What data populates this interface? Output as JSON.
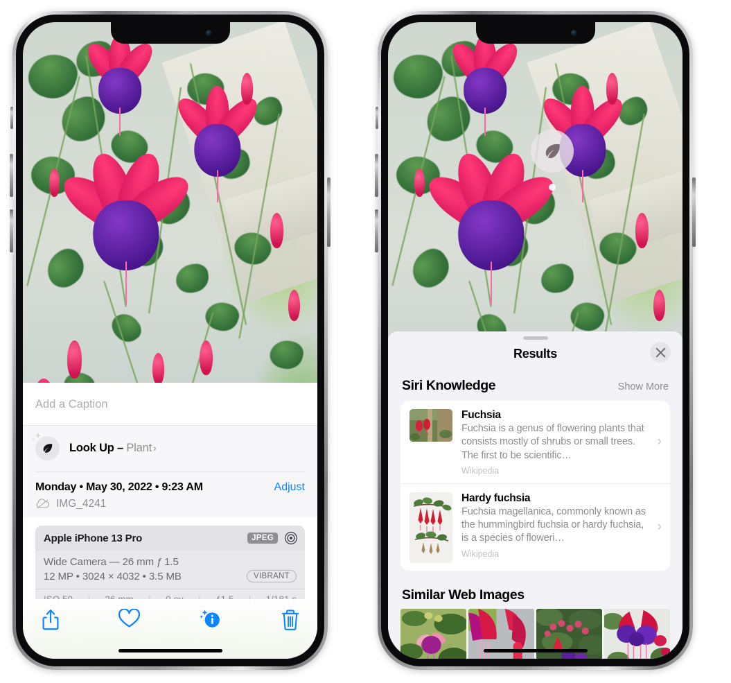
{
  "left_phone": {
    "caption_placeholder": "Add a Caption",
    "lookup": {
      "label": "Look Up – ",
      "subject": "Plant",
      "chevron": "›",
      "icon": "leaf-icon"
    },
    "date": "Monday • May 30, 2022 • 9:23 AM",
    "adjust_label": "Adjust",
    "file_name": "IMG_4241",
    "camera": {
      "model": "Apple iPhone 13 Pro",
      "format_badge": "JPEG",
      "lens_line": "Wide Camera — 26 mm ƒ 1.5",
      "specs_line": "12 MP • 3024 × 4032 • 3.5 MB",
      "style_badge": "VIBRANT",
      "exif": [
        "ISO 50",
        "26 mm",
        "0 ev",
        "ƒ1.5",
        "1/181 s"
      ],
      "exif_separator": "|"
    },
    "toolbar": [
      {
        "name": "share-button",
        "label": "Share"
      },
      {
        "name": "favorite-button",
        "label": "Favorite"
      },
      {
        "name": "info-button",
        "label": "Info"
      },
      {
        "name": "delete-button",
        "label": "Delete"
      }
    ]
  },
  "right_phone": {
    "visual_lookup_badge": "leaf-icon",
    "results_title": "Results",
    "close_label": "Close",
    "siri_knowledge": {
      "title": "Siri Knowledge",
      "show_more": "Show More",
      "items": [
        {
          "title": "Fuchsia",
          "description": "Fuchsia is a genus of flowering plants that consists mostly of shrubs or small trees. The first to be scientific…",
          "source": "Wikipedia",
          "chevron": "›"
        },
        {
          "title": "Hardy fuchsia",
          "description": "Fuchsia magellanica, commonly known as the hummingbird fuchsia or hardy fuchsia, is a species of floweri…",
          "source": "Wikipedia",
          "chevron": "›"
        }
      ]
    },
    "similar_web_images": {
      "title": "Similar Web Images",
      "count": 4
    }
  },
  "colors": {
    "accent_blue": "#0a84ff",
    "sheet_gray": "#f2f2f7",
    "secondary_text": "#8e8e93",
    "card_white": "#ffffff",
    "badge_gray": "#8e8e93"
  }
}
